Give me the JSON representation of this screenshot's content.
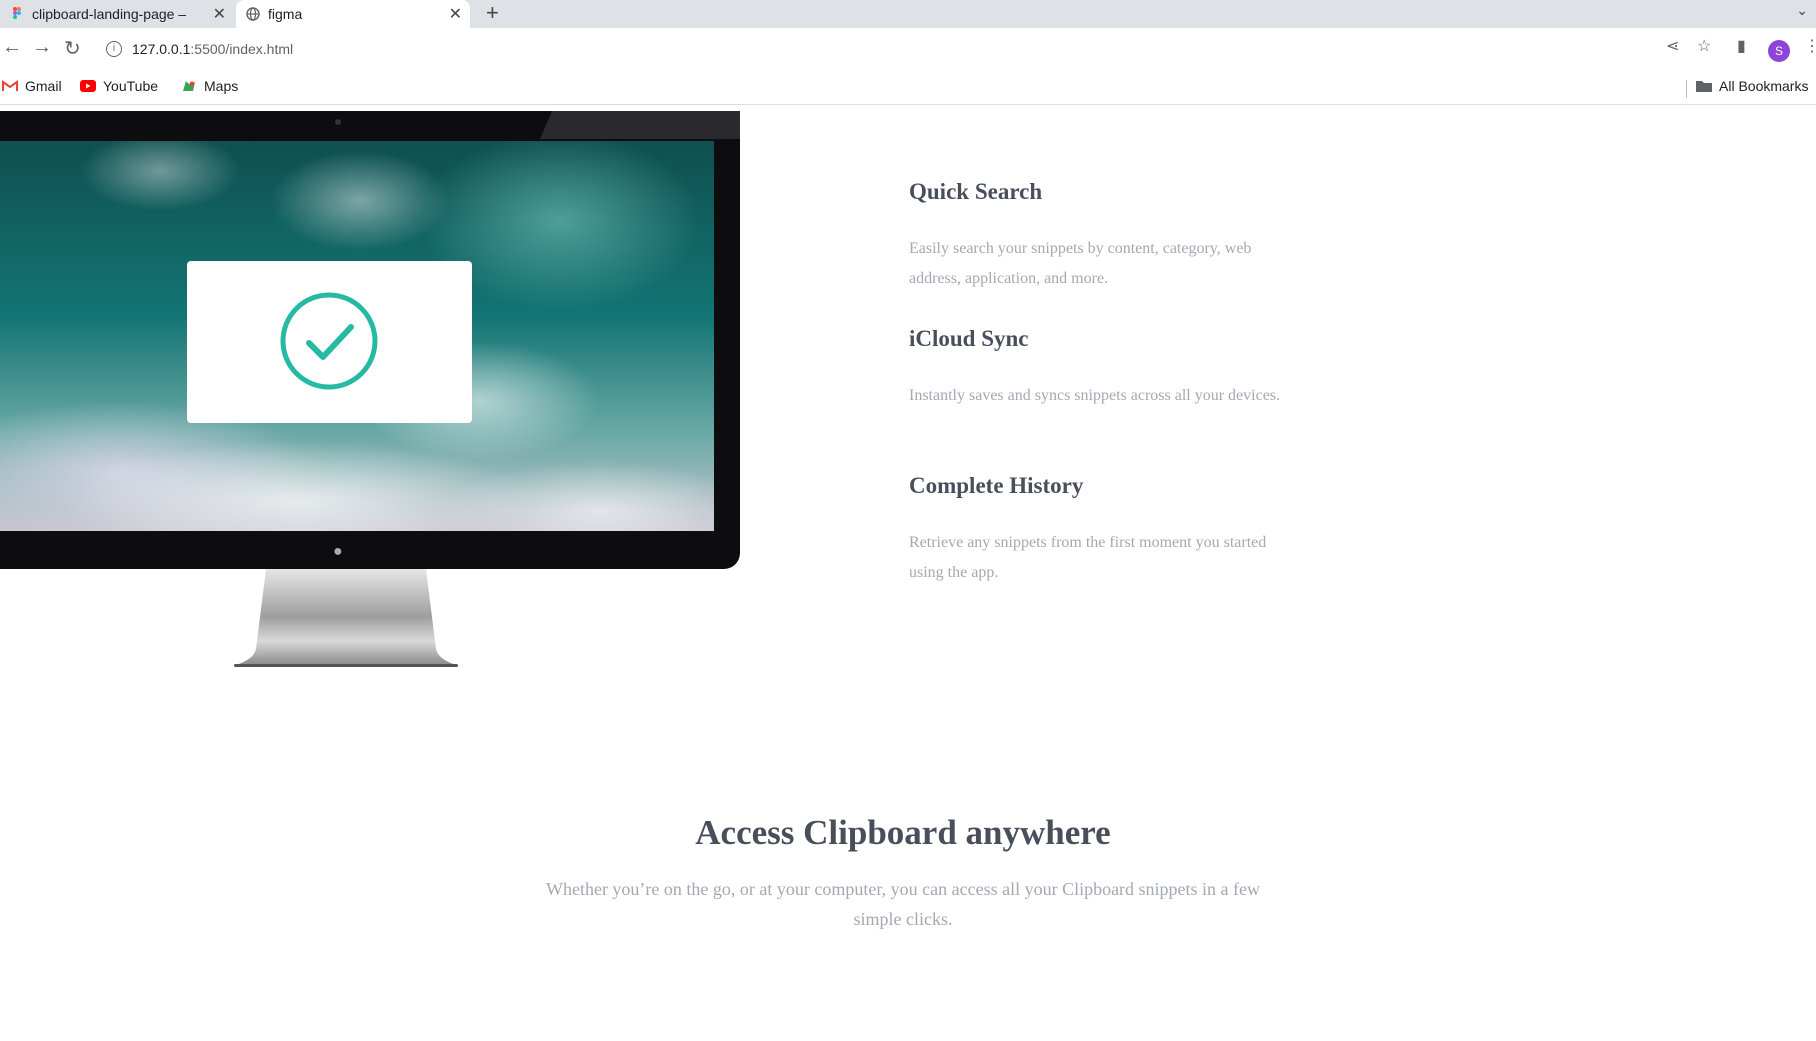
{
  "browser": {
    "tabs": [
      {
        "title": "clipboard-landing-page – "
      },
      {
        "title": "figma"
      }
    ],
    "url_host": "127.0.0.1",
    "url_path": ":5500/index.html",
    "profile_initial": "S",
    "bookmarks": [
      "Gmail",
      "YouTube",
      "Maps"
    ],
    "all_bookmarks_label": "All Bookmarks"
  },
  "features": [
    {
      "title": "Quick Search",
      "description": "Easily search your snippets by content, category, web address, application, and more."
    },
    {
      "title": "iCloud Sync",
      "description": "Instantly saves and syncs snippets across all your devices."
    },
    {
      "title": "Complete History",
      "description": "Retrieve any snippets from the first moment you started using the app."
    }
  ],
  "access": {
    "title": "Access Clipboard anywhere",
    "description": "Whether you’re on the go, or at your computer, you can access all your Clipboard snippets in a few simple clicks."
  },
  "colors": {
    "heading": "#484f5b",
    "body_text": "#a3a8b2",
    "check_accent": "#26ba a3"
  }
}
